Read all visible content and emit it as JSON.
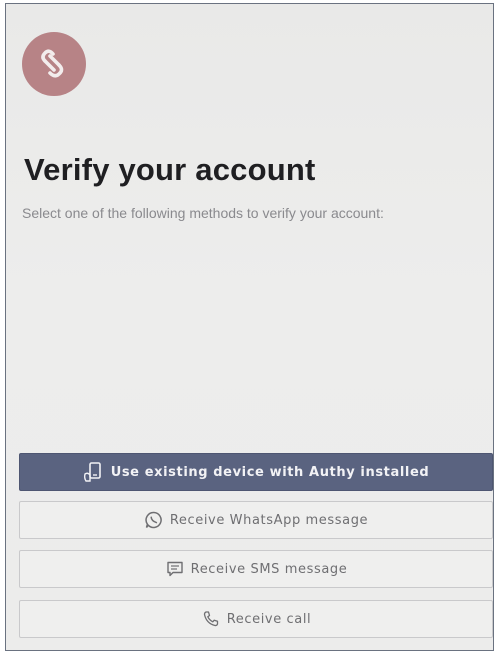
{
  "app": {
    "logo_icon": "authy-logo-icon",
    "brand_color": "#b78386"
  },
  "main": {
    "title": "Verify your account",
    "subtitle": "Select one of the following methods to verify your account:"
  },
  "methods": [
    {
      "label": "Use existing device with Authy installed",
      "icon": "device-icon",
      "primary": true
    },
    {
      "label": "Receive WhatsApp message",
      "icon": "whatsapp-icon",
      "primary": false
    },
    {
      "label": "Receive SMS message",
      "icon": "sms-icon",
      "primary": false
    },
    {
      "label": "Receive call",
      "icon": "phone-icon",
      "primary": false
    }
  ],
  "colors": {
    "primary_button": "#5a6380",
    "secondary_button": "#efefee",
    "text_dark": "#1f1f22",
    "text_muted": "#8a8a8e"
  }
}
